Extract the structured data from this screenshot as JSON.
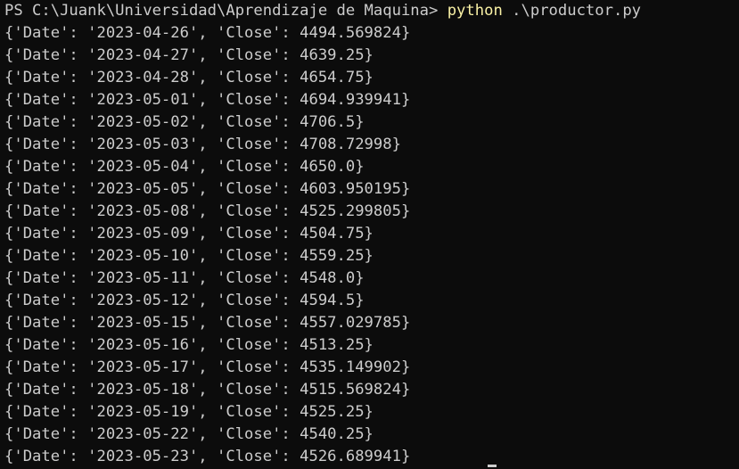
{
  "terminal": {
    "prompt": "PS C:\\Juank\\Universidad\\Aprendizaje de Maquina> ",
    "command_exec": "python",
    "command_args": " .\\productor.py",
    "output_lines": [
      "{'Date': '2023-04-26', 'Close': 4494.569824}",
      "{'Date': '2023-04-27', 'Close': 4639.25}",
      "{'Date': '2023-04-28', 'Close': 4654.75}",
      "{'Date': '2023-05-01', 'Close': 4694.939941}",
      "{'Date': '2023-05-02', 'Close': 4706.5}",
      "{'Date': '2023-05-03', 'Close': 4708.72998}",
      "{'Date': '2023-05-04', 'Close': 4650.0}",
      "{'Date': '2023-05-05', 'Close': 4603.950195}",
      "{'Date': '2023-05-08', 'Close': 4525.299805}",
      "{'Date': '2023-05-09', 'Close': 4504.75}",
      "{'Date': '2023-05-10', 'Close': 4559.25}",
      "{'Date': '2023-05-11', 'Close': 4548.0}",
      "{'Date': '2023-05-12', 'Close': 4594.5}",
      "{'Date': '2023-05-15', 'Close': 4557.029785}",
      "{'Date': '2023-05-16', 'Close': 4513.25}",
      "{'Date': '2023-05-17', 'Close': 4535.149902}",
      "{'Date': '2023-05-18', 'Close': 4515.569824}",
      "{'Date': '2023-05-19', 'Close': 4525.25}",
      "{'Date': '2023-05-22', 'Close': 4540.25}",
      "{'Date': '2023-05-23', 'Close': 4526.689941}"
    ]
  },
  "colors": {
    "background": "#0c0c0c",
    "text": "#cccccc",
    "command": "#f9f1a5"
  }
}
